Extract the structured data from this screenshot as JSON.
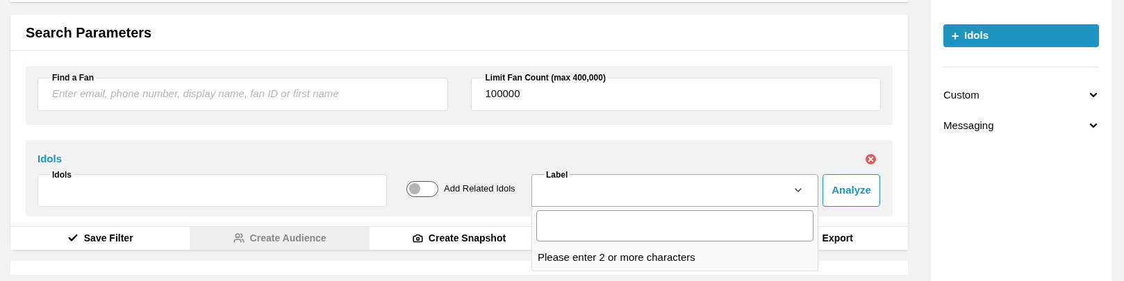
{
  "header": {
    "title": "Search Parameters"
  },
  "fields": [
    {
      "label": "Find a Fan",
      "placeholder": "Enter email, phone number, display name, fan ID or first name"
    },
    {
      "label": "Limit Fan Count (max 400,000)",
      "value": "100000"
    }
  ],
  "filter": {
    "title": "Idols",
    "idols_field": {
      "label": "Idols"
    },
    "toggle": {
      "label": "Add Related Idols",
      "on": false
    },
    "select": {
      "label": "Label",
      "expanded": true
    },
    "dropdown": {
      "message": "Please enter 2 or more characters"
    },
    "analyze_button": "Analyze"
  },
  "footer_buttons": [
    {
      "label": "Save Filter",
      "kind": "save",
      "disabled": false
    },
    {
      "label": "Create Audience",
      "kind": "audience",
      "disabled": true
    },
    {
      "label": "Create Snapshot",
      "kind": "snapshot",
      "disabled": false
    },
    {
      "label": "Export",
      "kind": "export",
      "disabled": false
    }
  ],
  "sidebar": {
    "add_button": "Idols",
    "sections": [
      {
        "label": "Custom",
        "expanded": false
      },
      {
        "label": "Messaging",
        "expanded": false
      }
    ]
  }
}
